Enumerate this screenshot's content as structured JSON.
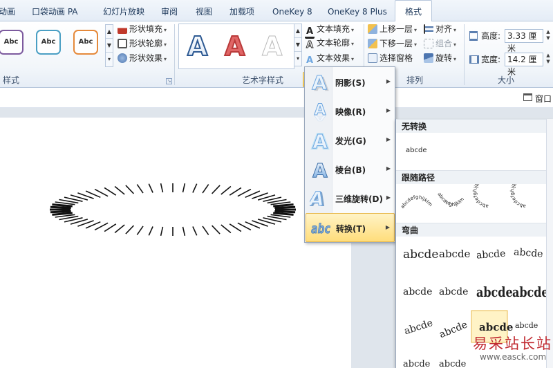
{
  "tabs": [
    "动画",
    "口袋动画 PA",
    "幻灯片放映",
    "审阅",
    "视图",
    "加载项",
    "OneKey 8",
    "OneKey 8 Plus",
    "格式"
  ],
  "ribbon": {
    "shape_styles": {
      "sample_label": "Abc",
      "fill": "形状填充",
      "outline": "形状轮廓",
      "effects": "形状效果",
      "group_label": "样式"
    },
    "wordart": {
      "glyph": "A",
      "text_fill": "文本填充",
      "text_outline": "文本轮廓",
      "text_effects": "文本效果",
      "group_label": "艺术字样式"
    },
    "arrange": {
      "bring_forward": "上移一层",
      "send_backward": "下移一层",
      "selection_pane": "选择窗格",
      "align": "对齐",
      "group": "组合",
      "rotate": "旋转",
      "group_label": "排列"
    },
    "size": {
      "height_label": "高度:",
      "height_value": "3.33 厘米",
      "width_label": "宽度:",
      "width_value": "14.2 厘米",
      "group_label": "大小"
    }
  },
  "subbar": {
    "window_label": "窗口"
  },
  "text_effects_menu": [
    {
      "label": "阴影(S)",
      "icon": "shadow-icon"
    },
    {
      "label": "映像(R)",
      "icon": "reflection-icon"
    },
    {
      "label": "发光(G)",
      "icon": "glow-icon"
    },
    {
      "label": "棱台(B)",
      "icon": "bevel-icon"
    },
    {
      "label": "三维旋转(D)",
      "icon": "3d-rotation-icon"
    },
    {
      "label": "转换(T)",
      "icon": "transform-icon",
      "highlighted": true
    }
  ],
  "transform_submenu": {
    "no_transform": "无转换",
    "sample_text": "abcde",
    "follow_path": "跟随路径",
    "path_ring_text": "abcdefghijklm",
    "warp": "弯曲"
  },
  "watermark": {
    "title": "易采站长站",
    "url": "www.easck.com"
  },
  "colors": {
    "accent": "#1e395b",
    "hover": "#ffdd7b",
    "tab_bg": "#e4ecf6"
  }
}
